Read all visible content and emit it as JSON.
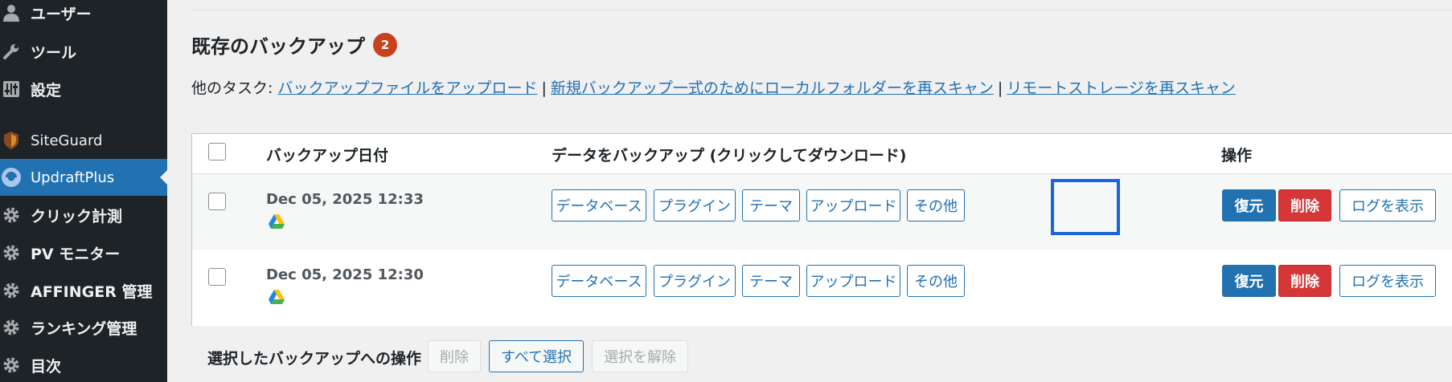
{
  "sidebar": {
    "items": [
      {
        "label": "ユーザー",
        "icon": "user-icon"
      },
      {
        "label": "ツール",
        "icon": "wrench-icon"
      },
      {
        "label": "設定",
        "icon": "settings-sliders-icon"
      },
      {
        "label": "SiteGuard",
        "icon": "siteguard-icon"
      },
      {
        "label": "UpdraftPlus",
        "icon": "updraftplus-icon",
        "active": true
      },
      {
        "label": "クリック計測",
        "icon": "gear-icon"
      },
      {
        "label": "PV モニター",
        "icon": "gear-icon"
      },
      {
        "label": "AFFINGER 管理",
        "icon": "gear-icon"
      },
      {
        "label": "ランキング管理",
        "icon": "gear-icon"
      },
      {
        "label": "目次",
        "icon": "gear-icon"
      }
    ]
  },
  "section": {
    "title": "既存のバックアップ",
    "count": "2"
  },
  "other_tasks": {
    "label": "他のタスク:",
    "links": [
      "バックアップファイルをアップロード",
      "新規バックアップ一式のためにローカルフォルダーを再スキャン",
      "リモートストレージを再スキャン"
    ],
    "separator": "|"
  },
  "table": {
    "headers": {
      "date": "バックアップ日付",
      "data": "データをバックアップ (クリックしてダウンロード)",
      "actions": "操作"
    },
    "rows": [
      {
        "date": "Dec 05, 2025 12:33",
        "storage_icon": "google-drive-icon",
        "downloads": [
          "データベース",
          "プラグイン",
          "テーマ",
          "アップロード",
          "その他"
        ],
        "actions": {
          "restore": "復元",
          "delete": "削除",
          "log": "ログを表示"
        }
      },
      {
        "date": "Dec 05, 2025 12:30",
        "storage_icon": "google-drive-icon",
        "downloads": [
          "データベース",
          "プラグイン",
          "テーマ",
          "アップロード",
          "その他"
        ],
        "actions": {
          "restore": "復元",
          "delete": "削除",
          "log": "ログを表示"
        }
      }
    ]
  },
  "bulk": {
    "label": "選択したバックアップへの操作",
    "delete": "削除",
    "select_all": "すべて選択",
    "deselect": "選択を解除"
  },
  "colors": {
    "sidebar_bg": "#1d2327",
    "active_bg": "#2271b1",
    "link": "#2271b1",
    "delete": "#d63638",
    "badge": "#c9401d",
    "highlight": "#1a66d9"
  }
}
